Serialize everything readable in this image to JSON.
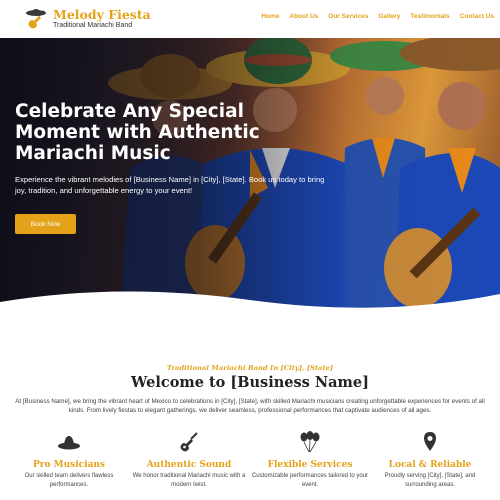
{
  "brand": {
    "name": "Melody Fiesta",
    "tagline": "Traditional Mariachi Band",
    "accent": "#e3a21a"
  },
  "nav": {
    "items": [
      {
        "label": "Home"
      },
      {
        "label": "About Us"
      },
      {
        "label": "Our Services"
      },
      {
        "label": "Gallery"
      },
      {
        "label": "Testimonials"
      },
      {
        "label": "Contact Us"
      }
    ]
  },
  "hero": {
    "title": "Celebrate Any Special Moment with Authentic Mariachi Music",
    "text": "Experience the vibrant melodies of [Business Name] in [City], [State]. Book us today to bring joy, tradition, and unforgettable energy to your event!",
    "button": "Book Now"
  },
  "welcome": {
    "eyebrow": "Traditional Mariachi Band In [City], [State]",
    "title": "Welcome to [Business Name]",
    "text": "At [Business Name], we bring the vibrant heart of Mexico to celebrations in [City], [State], with skilled Mariachi musicians creating unforgettable experiences for events of all kinds. From lively fiestas to elegant gatherings, we deliver seamless, professional performances that captivate audiences of all ages."
  },
  "features": [
    {
      "icon": "sombrero-icon",
      "title": "Pro Musicians",
      "text": "Our skilled team delivers flawless performances."
    },
    {
      "icon": "guitar-icon",
      "title": "Authentic Sound",
      "text": "We honor traditional Mariachi music with a modern twist."
    },
    {
      "icon": "balloons-icon",
      "title": "Flexible Services",
      "text": "Customizable performances tailored to your event."
    },
    {
      "icon": "location-pin-icon",
      "title": "Local & Reliable",
      "text": "Proudly serving [City], [State], and surrounding areas."
    }
  ]
}
